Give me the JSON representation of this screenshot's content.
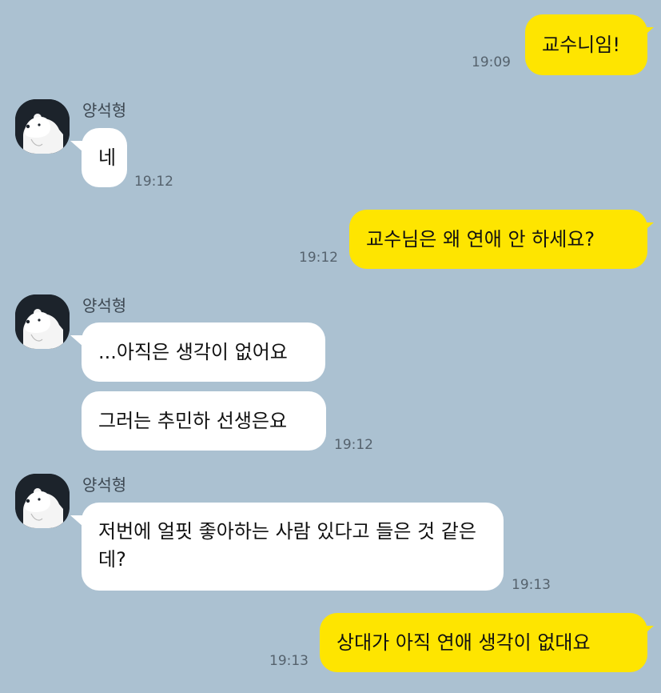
{
  "chat": {
    "sender_name": "양석형",
    "colors": {
      "background": "#abc1d1",
      "my_bubble": "#fee500",
      "their_bubble": "#ffffff"
    },
    "avatar_icon": "polar-bear-icon",
    "messages": [
      {
        "from": "me",
        "text": "교수니임!",
        "time": "19:09"
      },
      {
        "from": "other",
        "text": "네",
        "time": "19:12"
      },
      {
        "from": "me",
        "text": "교수님은 왜 연애 안 하세요?",
        "time": "19:12"
      },
      {
        "from": "other",
        "text": "...아직은 생각이 없어요",
        "time": ""
      },
      {
        "from": "other",
        "text": "그러는 추민하 선생은요",
        "time": "19:12"
      },
      {
        "from": "other",
        "text": "저번에 얼핏 좋아하는 사람 있다고 들은 것 같은데?",
        "time": "19:13"
      },
      {
        "from": "me",
        "text": "상대가 아직 연애 생각이 없대요",
        "time": "19:13"
      }
    ]
  }
}
